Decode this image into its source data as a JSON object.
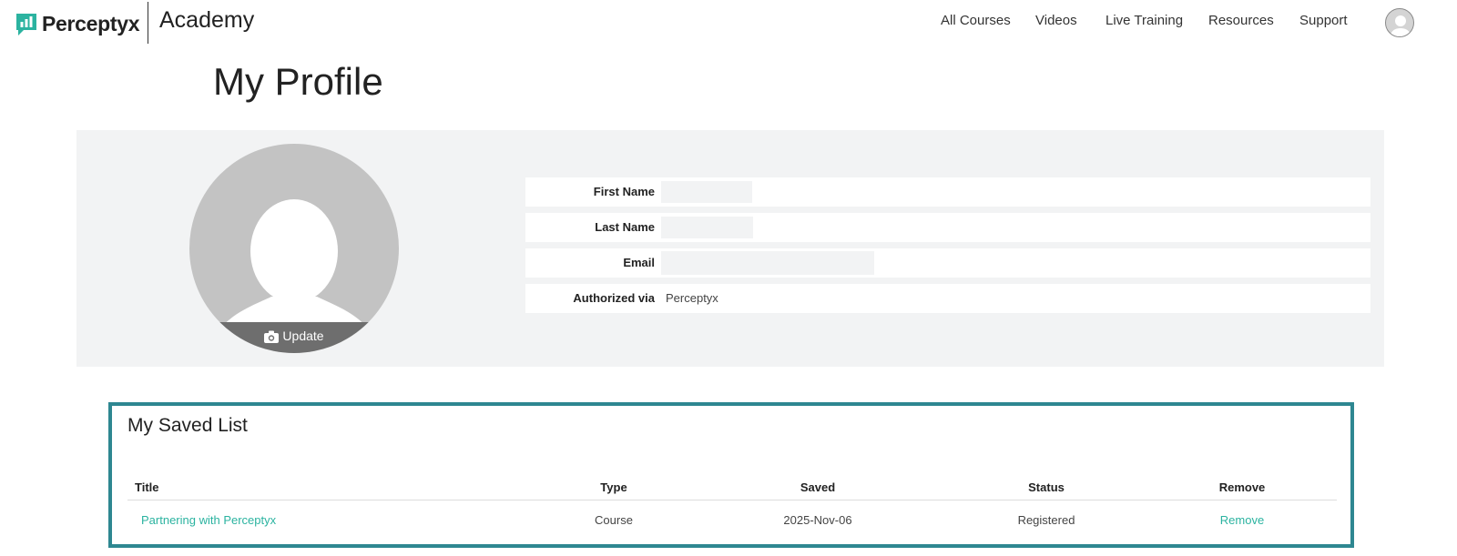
{
  "header": {
    "brand": "Perceptyx",
    "product": "Academy",
    "nav": [
      "All Courses",
      "Videos",
      "Live Training",
      "Resources",
      "Support"
    ]
  },
  "page": {
    "title": "My Profile"
  },
  "profile": {
    "update_label": "Update",
    "fields": {
      "first_name_label": "First Name",
      "last_name_label": "Last Name",
      "email_label": "Email",
      "authorized_label": "Authorized via",
      "authorized_value": "Perceptyx"
    }
  },
  "saved_list": {
    "title": "My Saved List",
    "columns": [
      "Title",
      "Type",
      "Saved",
      "Status",
      "Remove"
    ],
    "rows": [
      {
        "title": "Partnering with Perceptyx",
        "type": "Course",
        "saved": "2025-Nov-06",
        "status": "Registered",
        "remove": "Remove"
      }
    ]
  },
  "colors": {
    "brand_teal": "#2e8791",
    "link_green": "#2bb3a0",
    "panel_gray": "#f2f3f4"
  }
}
